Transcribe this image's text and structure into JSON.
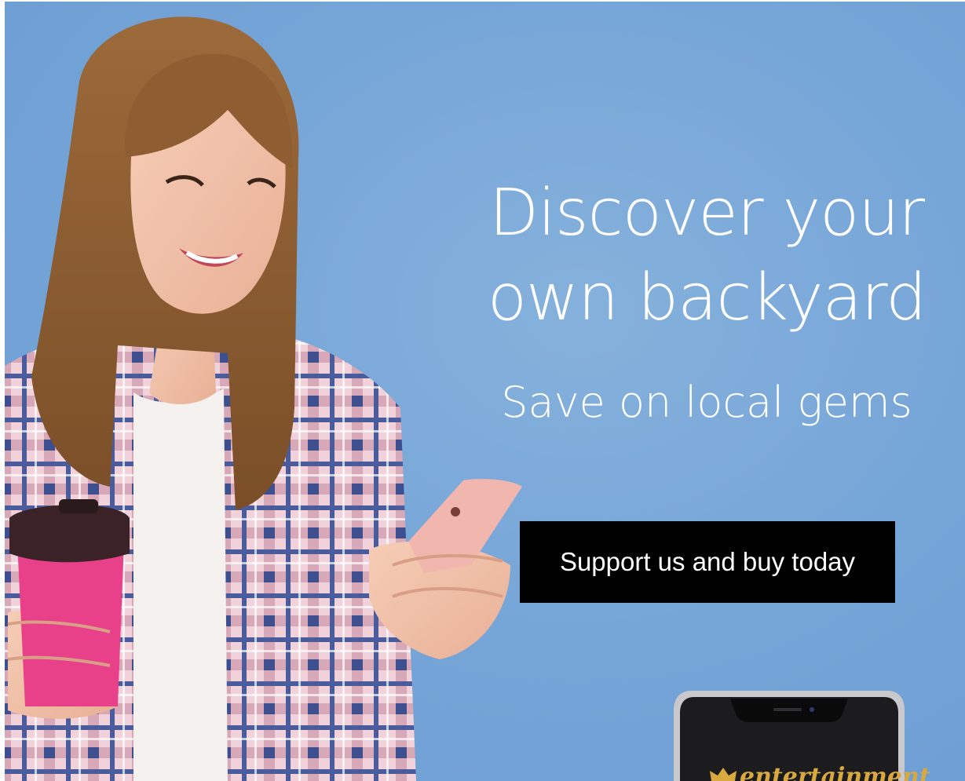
{
  "banner": {
    "headline_line1": "Discover your",
    "headline_line2": "own backyard",
    "subheadline": "Save on local gems",
    "cta_label": "Support us and buy today",
    "app_logo_text": "entertainment"
  },
  "colors": {
    "background": "#77a6d8",
    "cta_background": "#000000",
    "cta_text": "#ffffff",
    "cup": "#e9408a",
    "logo_gold": "#d9a93f"
  },
  "icons": [
    "crown-icon"
  ]
}
